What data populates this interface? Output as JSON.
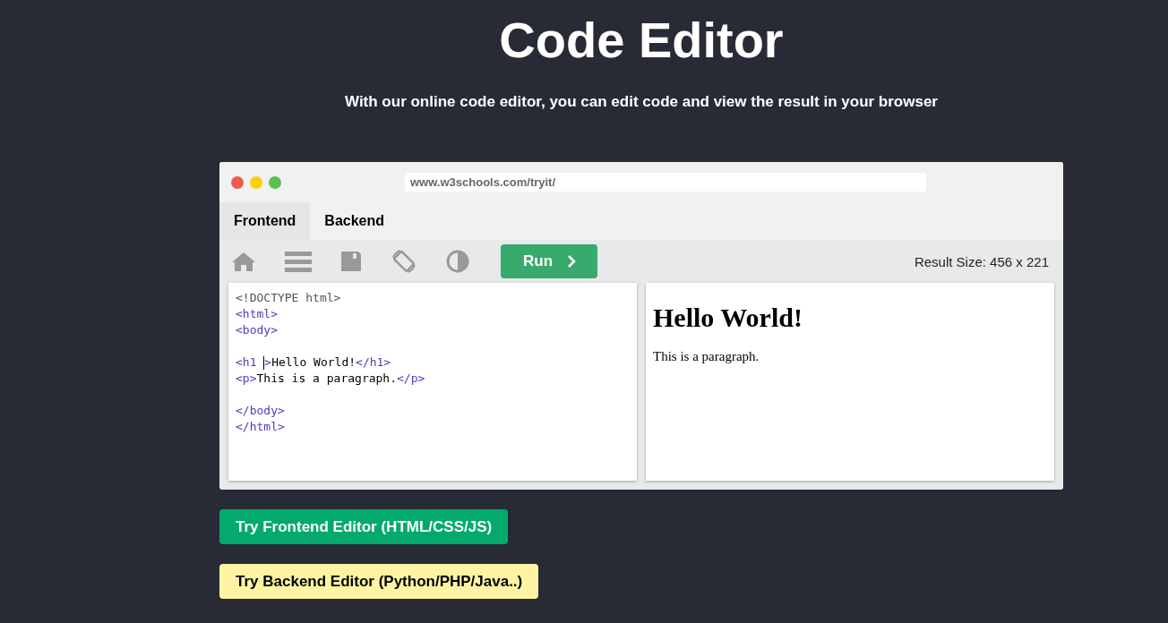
{
  "title": "Code Editor",
  "subtitle": "With our online code editor, you can edit code and view the result in your browser",
  "editor": {
    "address": "www.w3schools.com/tryit/",
    "tabs": [
      {
        "label": "Frontend",
        "selected": true
      },
      {
        "label": "Backend",
        "selected": false
      }
    ],
    "run_button": "Run",
    "result_size": "Result Size: 456 x 221",
    "code_lines": [
      {
        "kind": "code",
        "tokens": [
          {
            "kind": "doctype",
            "text": "<!DOCTYPE html>"
          }
        ]
      },
      {
        "kind": "code",
        "tokens": [
          {
            "kind": "tag",
            "text": "<html>"
          }
        ]
      },
      {
        "kind": "code",
        "tokens": [
          {
            "kind": "tag",
            "text": "<body>"
          }
        ]
      },
      {
        "kind": "blank"
      },
      {
        "kind": "code",
        "caret": true,
        "tokens": [
          {
            "kind": "tag",
            "text": "<h1 "
          },
          {
            "kind": "tag",
            "text": ">"
          },
          {
            "kind": "text",
            "text": "Hello World!"
          },
          {
            "kind": "tag",
            "text": "</h1>"
          }
        ]
      },
      {
        "kind": "code",
        "tokens": [
          {
            "kind": "tag",
            "text": "<p>"
          },
          {
            "kind": "text",
            "text": "This is a paragraph."
          },
          {
            "kind": "tag",
            "text": "</p>"
          }
        ]
      },
      {
        "kind": "blank"
      },
      {
        "kind": "code",
        "tokens": [
          {
            "kind": "tag",
            "text": "</body>"
          }
        ]
      },
      {
        "kind": "code",
        "tokens": [
          {
            "kind": "tag",
            "text": "</html>"
          }
        ]
      }
    ],
    "result": {
      "heading": "Hello World!",
      "paragraph": "This is a paragraph."
    }
  },
  "buttons": [
    {
      "kind": "frontend",
      "label": "Try Frontend Editor (HTML/CSS/JS)"
    },
    {
      "kind": "backend",
      "label": "Try Backend Editor (Python/PHP/Java..)"
    }
  ]
}
